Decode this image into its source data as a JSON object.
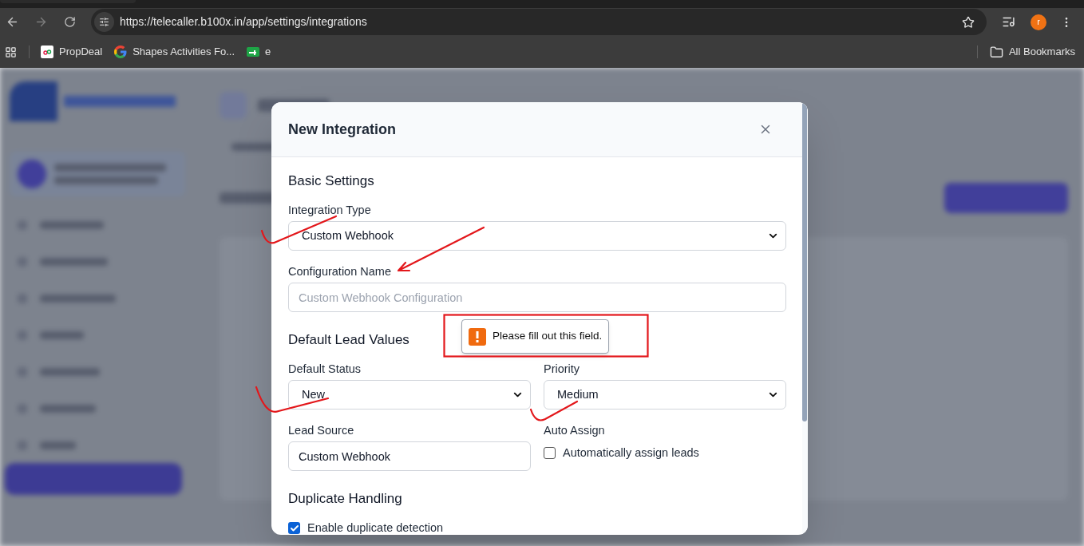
{
  "browser": {
    "url": "https://telecaller.b100x.in/app/settings/integrations",
    "profile_initial": "r",
    "all_bookmarks": "All Bookmarks",
    "bookmarks": [
      {
        "kind": "propdeal",
        "label": "PropDeal"
      },
      {
        "kind": "google",
        "label": "Shapes Activities Fo..."
      },
      {
        "kind": "green",
        "label": "e"
      }
    ]
  },
  "modal": {
    "title": "New Integration",
    "sections": [
      {
        "heading": "Basic Settings",
        "rows": [
          [
            {
              "kind": "select",
              "label": "Integration Type",
              "value": "Custom Webhook"
            }
          ],
          [
            {
              "kind": "input",
              "label": "Configuration Name",
              "placeholder": "Custom Webhook Configuration",
              "tooltip": "Please fill out this field."
            }
          ]
        ]
      },
      {
        "heading": "Default Lead Values",
        "rows": [
          [
            {
              "kind": "select",
              "label": "Default Status",
              "value": "New"
            },
            {
              "kind": "select",
              "label": "Priority",
              "value": "Medium"
            }
          ],
          [
            {
              "kind": "input",
              "label": "Lead Source",
              "value": "Custom Webhook"
            },
            {
              "kind": "checkbox",
              "label": "Auto Assign",
              "option": "Automatically assign leads",
              "checked": false
            }
          ]
        ]
      },
      {
        "heading": "Duplicate Handling",
        "rows": [
          [
            {
              "kind": "checkbox",
              "option": "Enable duplicate detection",
              "checked": true
            }
          ]
        ]
      }
    ]
  }
}
